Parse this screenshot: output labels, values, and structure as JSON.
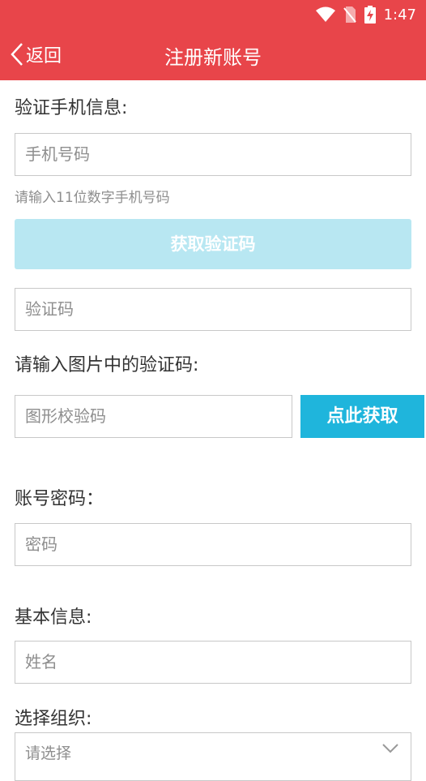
{
  "status_bar": {
    "time": "1:47",
    "icons": [
      "wifi-icon",
      "no-sim-icon",
      "battery-charging-icon"
    ]
  },
  "header": {
    "back_label": "返回",
    "title": "注册新账号",
    "color": "#e8454a"
  },
  "phone_section": {
    "label": "验证手机信息:",
    "phone_placeholder": "手机号码",
    "phone_hint": "请输入11位数字手机号码",
    "get_sms_button": "获取验证码",
    "sms_code_placeholder": "验证码"
  },
  "captcha_section": {
    "label": "请输入图片中的验证码:",
    "captcha_placeholder": "图形校验码",
    "get_captcha_button": "点此获取"
  },
  "password_section": {
    "label": "账号密码：",
    "password_placeholder": "密码"
  },
  "basic_info_section": {
    "label": "基本信息:",
    "name_placeholder": "姓名"
  },
  "org_section": {
    "label": "选择组织:",
    "select_value": "请选择"
  },
  "colors": {
    "accent": "#1fb5dc",
    "disabled_button": "#b8e7f2",
    "header": "#e8454a"
  }
}
